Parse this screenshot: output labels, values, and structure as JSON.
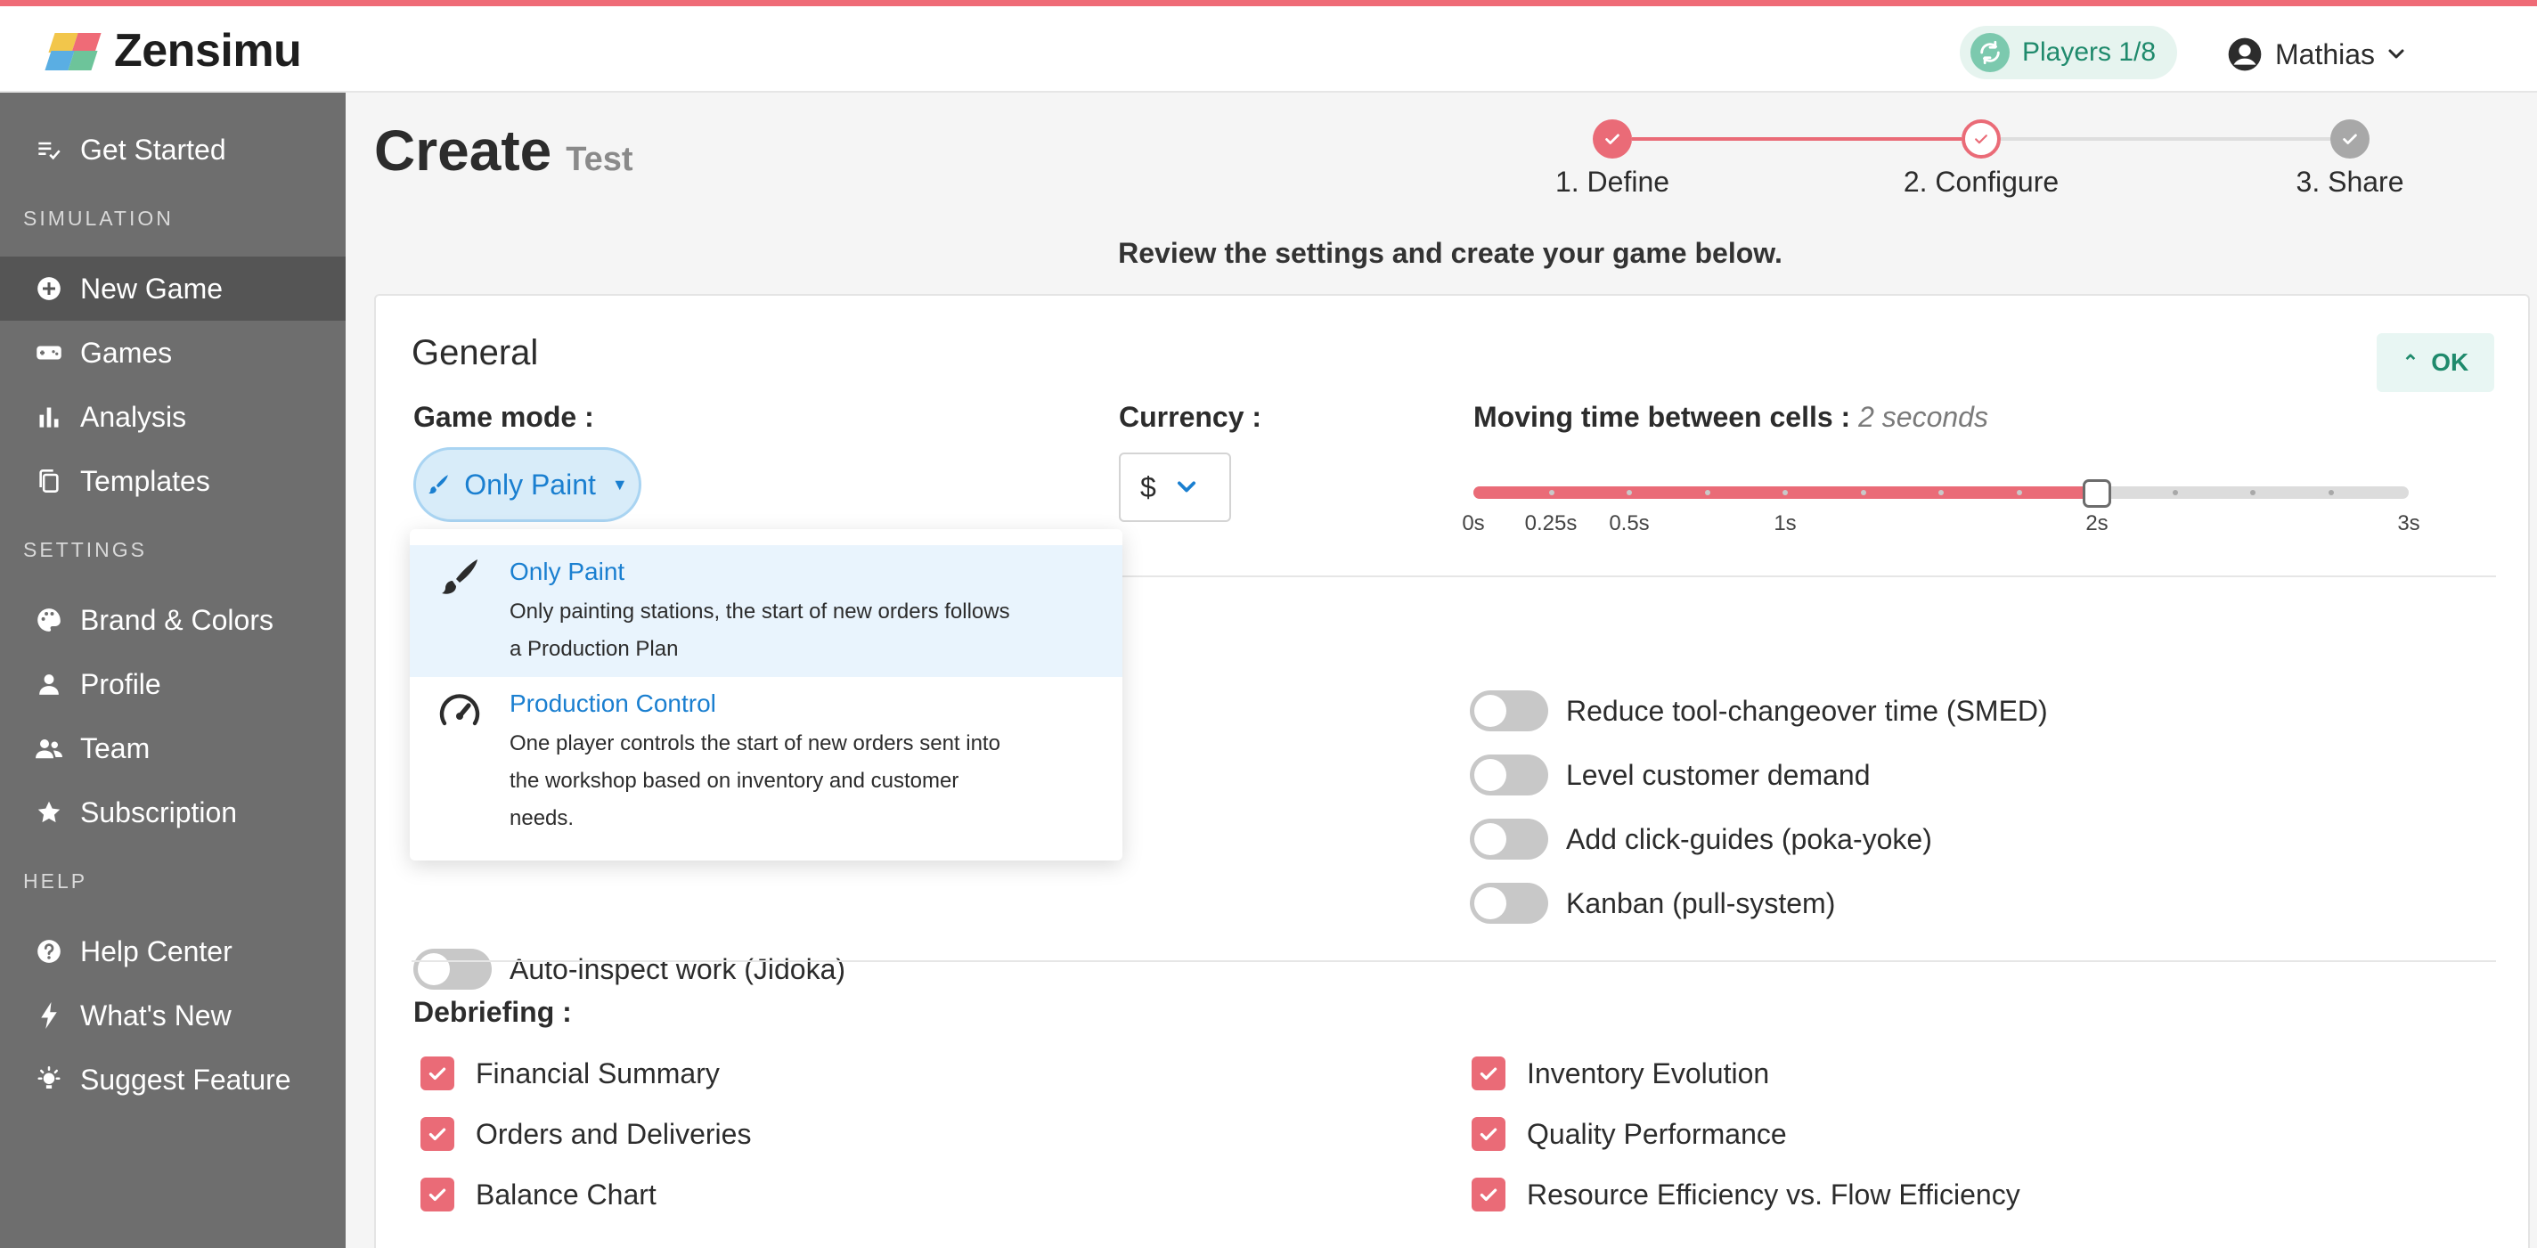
{
  "app": {
    "logo_text": "Zensimu",
    "players_label": "Players 1/8",
    "user_name": "Mathias"
  },
  "colors": {
    "accent": "#ea6b77",
    "sidebar": "#6e6e6e",
    "link_blue": "#1a7fd0",
    "ok_green": "#1f8a6c"
  },
  "sidebar": {
    "get_started": "Get Started",
    "sections": {
      "simulation": "SIMULATION",
      "settings": "SETTINGS",
      "help": "HELP"
    },
    "simulation_items": [
      {
        "label": "New Game",
        "icon": "plus-circle-icon",
        "active": true
      },
      {
        "label": "Games",
        "icon": "gamepad-icon"
      },
      {
        "label": "Analysis",
        "icon": "bar-chart-icon"
      },
      {
        "label": "Templates",
        "icon": "copy-icon"
      }
    ],
    "settings_items": [
      {
        "label": "Brand & Colors",
        "icon": "palette-icon"
      },
      {
        "label": "Profile",
        "icon": "person-icon"
      },
      {
        "label": "Team",
        "icon": "people-icon"
      },
      {
        "label": "Subscription",
        "icon": "star-icon"
      }
    ],
    "help_items": [
      {
        "label": "Help Center",
        "icon": "question-circle-icon"
      },
      {
        "label": "What's New",
        "icon": "bolt-icon"
      },
      {
        "label": "Suggest Feature",
        "icon": "lightbulb-icon"
      }
    ]
  },
  "page": {
    "title": "Create",
    "subtitle": "Test",
    "review_text": "Review the settings and create your game below."
  },
  "stepper": {
    "steps": [
      {
        "label": "1. Define",
        "state": "done"
      },
      {
        "label": "2. Configure",
        "state": "current"
      },
      {
        "label": "3. Share",
        "state": "pending"
      }
    ]
  },
  "general": {
    "heading": "General",
    "ok_label": "OK",
    "game_mode_label": "Game mode :",
    "game_mode_value": "Only Paint",
    "currency_label": "Currency :",
    "currency_value": "$",
    "moving_time_label": "Moving time between cells :",
    "moving_time_value": "2 seconds",
    "slider": {
      "value_seconds": 2,
      "range_seconds": [
        0,
        3
      ],
      "tick_labels": [
        "0s",
        "0.25s",
        "0.5s",
        "1s",
        "2s",
        "3s"
      ]
    }
  },
  "dropdown": {
    "options": [
      {
        "title": "Only Paint",
        "description": "Only painting stations, the start of new orders follows a Production Plan",
        "icon": "paintbrush-icon",
        "selected": true
      },
      {
        "title": "Production Control",
        "description": "One player controls the start of new orders sent into the workshop based on inventory and customer needs.",
        "icon": "speedometer-icon",
        "selected": false
      }
    ]
  },
  "options": {
    "left": [
      {
        "label": "Auto-inspect work (Jidoka)",
        "on": false
      }
    ],
    "right": [
      {
        "label": "Reduce tool-changeover time (SMED)",
        "on": false
      },
      {
        "label": "Level customer demand",
        "on": false
      },
      {
        "label": "Add click-guides (poka-yoke)",
        "on": false
      },
      {
        "label": "Kanban (pull-system)",
        "on": false
      }
    ]
  },
  "debriefing": {
    "label": "Debriefing :",
    "left": [
      {
        "label": "Financial Summary",
        "checked": true
      },
      {
        "label": "Orders and Deliveries",
        "checked": true
      },
      {
        "label": "Balance Chart",
        "checked": true
      }
    ],
    "right": [
      {
        "label": "Inventory Evolution",
        "checked": true
      },
      {
        "label": "Quality Performance",
        "checked": true
      },
      {
        "label": "Resource Efficiency vs. Flow Efficiency",
        "checked": true
      }
    ]
  }
}
